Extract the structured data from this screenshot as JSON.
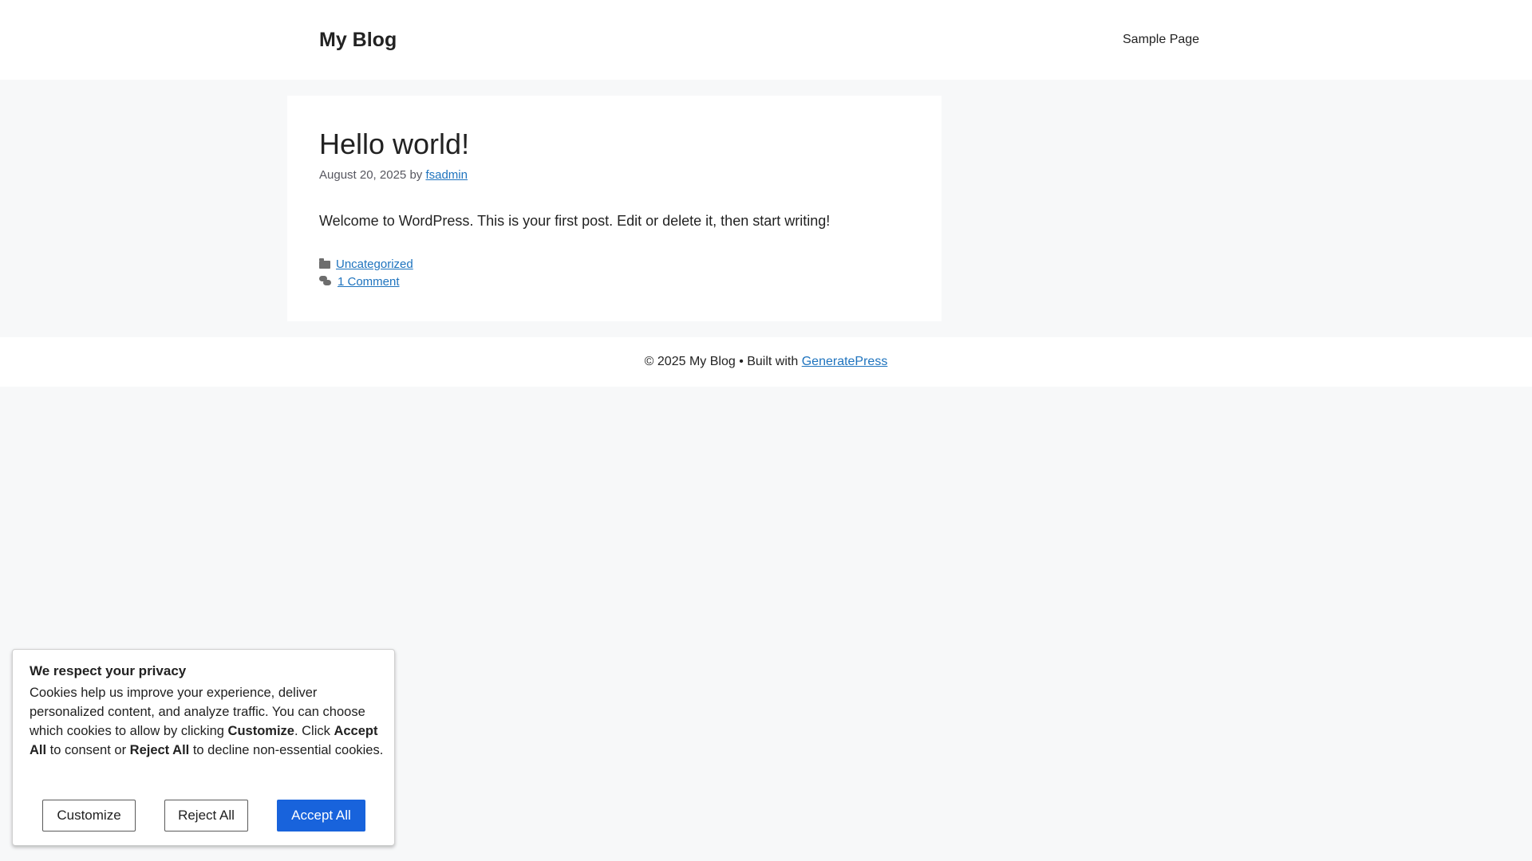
{
  "header": {
    "site_title": "My Blog",
    "nav": [
      "Sample Page"
    ]
  },
  "post": {
    "title": "Hello world!",
    "date": "August 20, 2025",
    "by": "by",
    "author": "fsadmin",
    "content": "Welcome to WordPress. This is your first post. Edit or delete it, then start writing!",
    "category": "Uncategorized",
    "comments": "1 Comment",
    "icons": [
      "folder-icon",
      "comments-icon"
    ]
  },
  "footer": {
    "copyright": "© 2025 My Blog • Built with",
    "theme_link": "GeneratePress"
  },
  "cookie_banner": {
    "title": "We respect your privacy",
    "body": {
      "part1": "Cookies help us improve your experience, deliver personalized content, and analyze traffic. You can choose which cookies to allow by clicking ",
      "customize": "Customize",
      "part2": ". Click ",
      "accept": "Accept All",
      "part3": " to consent or ",
      "reject": "Reject All",
      "part4": " to decline non-essential cookies."
    },
    "buttons": {
      "customize": "Customize",
      "reject": "Reject All",
      "accept": "Accept All"
    },
    "colors": {
      "accept_bg": "#1863dc"
    }
  },
  "colors": {
    "page_bg": "#f7f8f9",
    "link": "#1e73be"
  }
}
